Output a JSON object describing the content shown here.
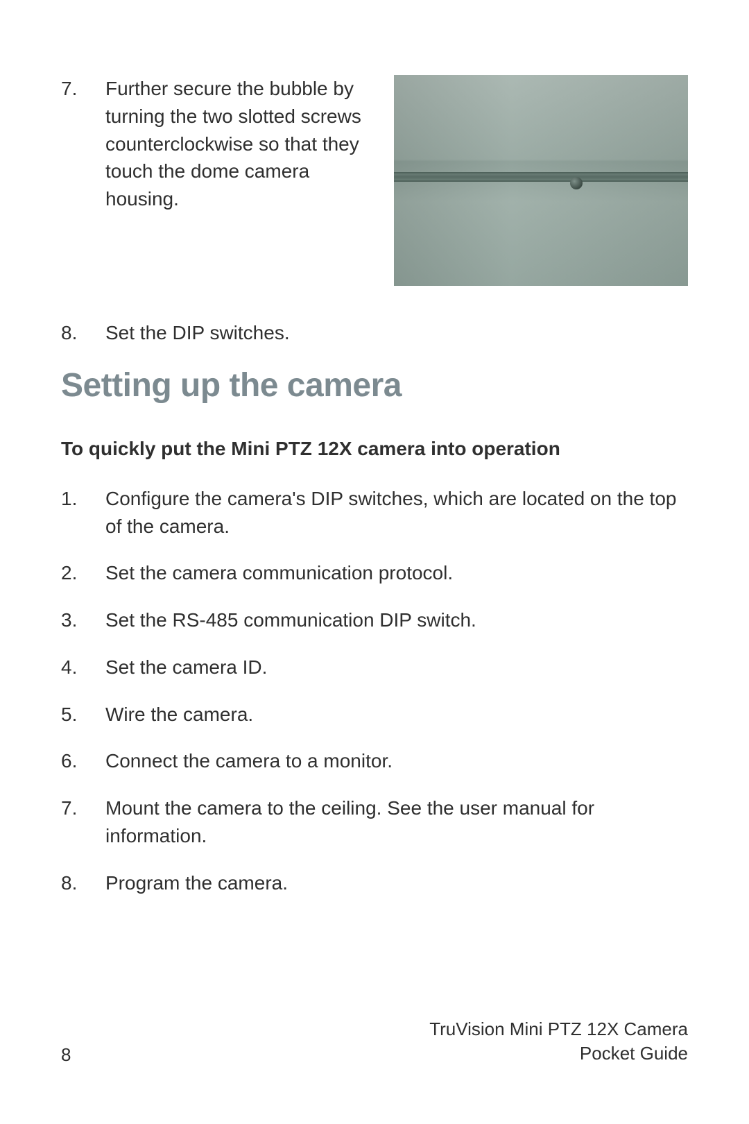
{
  "steps_top": [
    {
      "num": "7.",
      "text": "Further secure the bubble by turning the two slotted screws counterclockwise so that they touch the dome camera housing."
    },
    {
      "num": "8.",
      "text": "Set the DIP switches."
    }
  ],
  "section_heading": "Setting up the camera",
  "subheading": "To quickly put the Mini PTZ 12X camera into operation",
  "setup_steps": [
    {
      "num": "1.",
      "text": "Configure the camera's DIP switches, which are located on the top of the camera."
    },
    {
      "num": "2.",
      "text": "Set the camera communication protocol."
    },
    {
      "num": "3.",
      "text": "Set the RS-485 communication DIP switch."
    },
    {
      "num": "4.",
      "text": "Set the camera ID."
    },
    {
      "num": "5.",
      "text": "Wire the camera."
    },
    {
      "num": "6.",
      "text": "Connect the camera to a monitor."
    },
    {
      "num": "7.",
      "text": "Mount the camera to the ceiling. See the user manual for information."
    },
    {
      "num": "8.",
      "text": "Program the camera."
    }
  ],
  "footer": {
    "page_number": "8",
    "doc_title_line1": "TruVision Mini PTZ 12X Camera",
    "doc_title_line2": "Pocket Guide"
  }
}
